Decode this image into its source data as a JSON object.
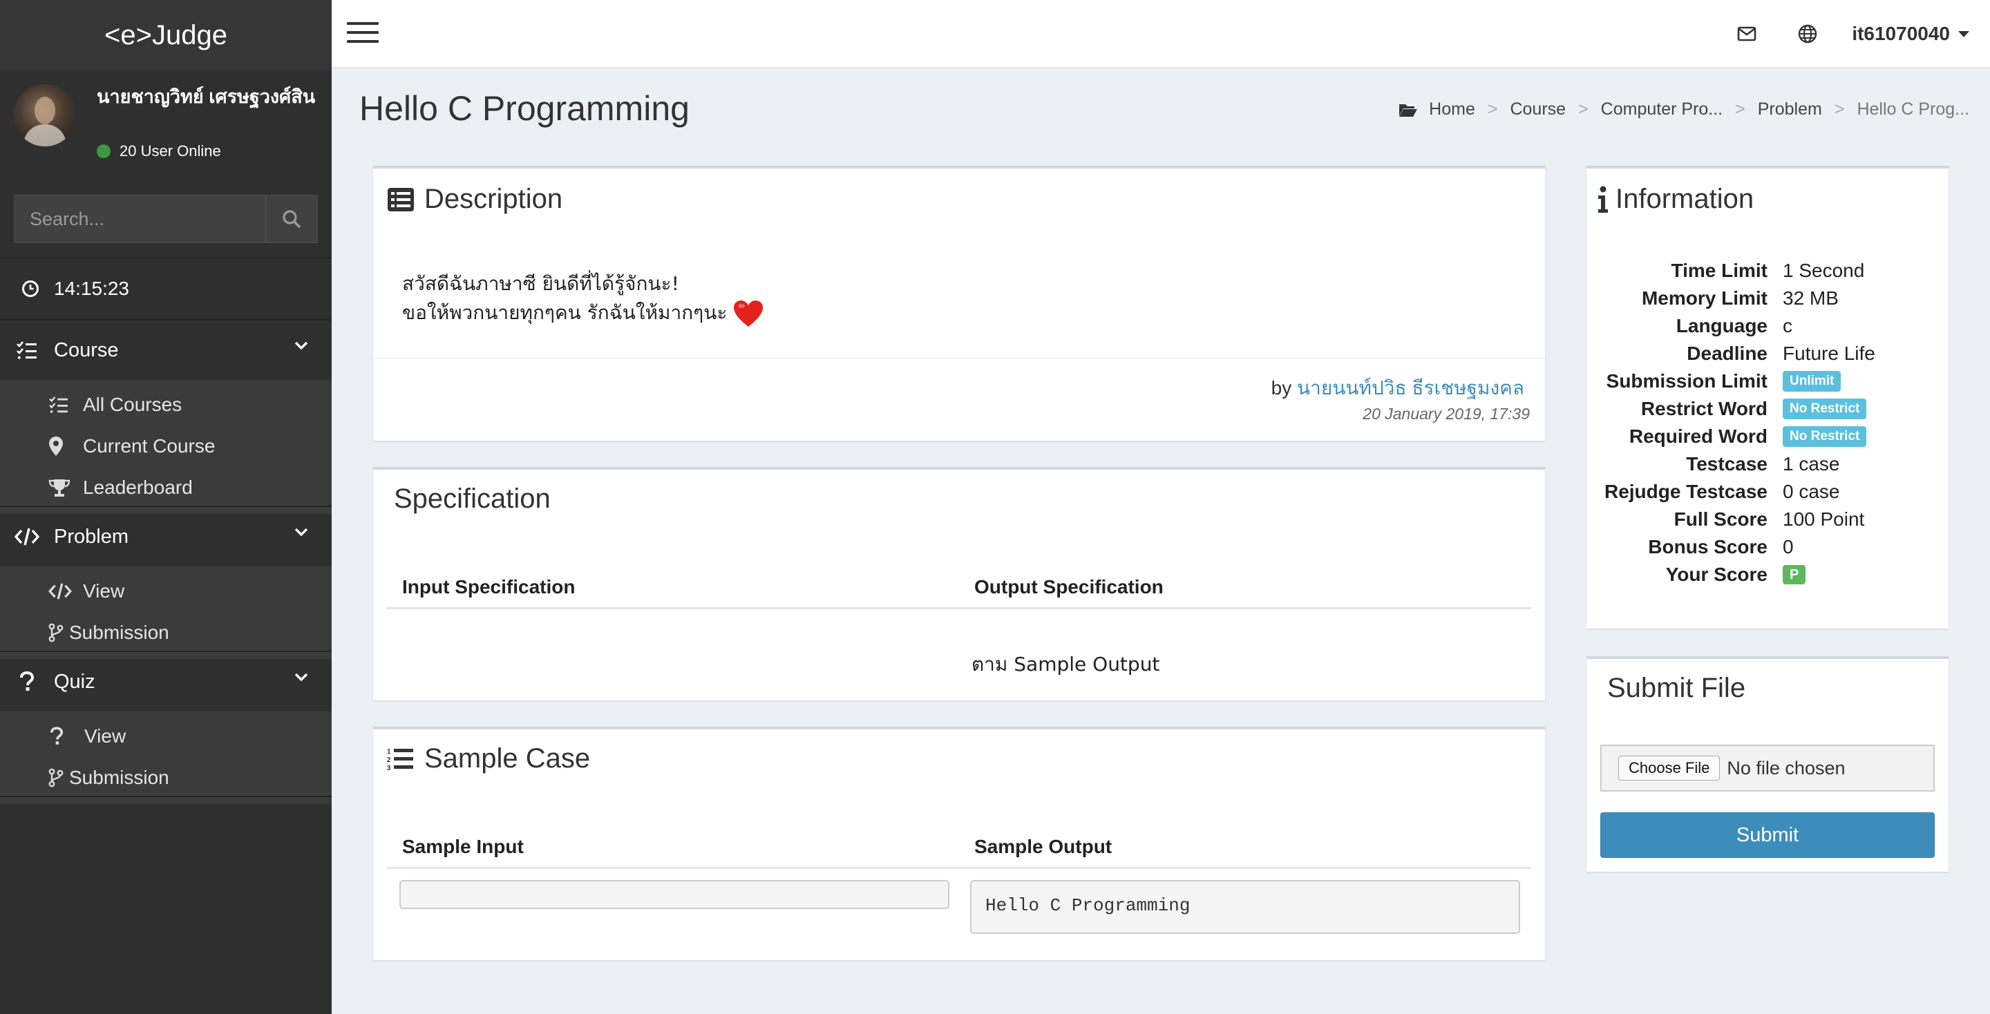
{
  "app": {
    "logo": "<e>Judge"
  },
  "user": {
    "name": "นายชาญวิทย์ เศรษฐวงศ์สิน",
    "online": "20 User Online",
    "username": "it61070040"
  },
  "search": {
    "placeholder": "Search..."
  },
  "clock": "14:15:23",
  "sidebar": {
    "course": {
      "label": "Course",
      "items": [
        "All Courses",
        "Current Course",
        "Leaderboard"
      ]
    },
    "problem": {
      "label": "Problem",
      "items": [
        "View",
        "Submission"
      ]
    },
    "quiz": {
      "label": "Quiz",
      "items": [
        "View",
        "Submission"
      ]
    }
  },
  "page": {
    "title": "Hello C Programming",
    "breadcrumb": [
      "Home",
      "Course",
      "Computer Pro...",
      "Problem",
      "Hello C Prog..."
    ]
  },
  "description": {
    "title": "Description",
    "line1": "สวัสดีฉันภาษาซี ยินดีที่ได้รู้จักนะ!",
    "line2": "ขอให้พวกนายทุกๆคน รักฉันให้มากๆนะ",
    "by": "by",
    "author": "นายนนท์ปวิธ ธีรเชษฐมงคล",
    "date": "20 January 2019, 17:39"
  },
  "specification": {
    "title": "Specification",
    "input_header": "Input Specification",
    "output_header": "Output Specification",
    "input_value": "",
    "output_value": "ตาม Sample Output"
  },
  "sample": {
    "title": "Sample Case",
    "input_header": "Sample Input",
    "output_header": "Sample Output",
    "input_value": "",
    "output_value": "Hello C Programming"
  },
  "information": {
    "title": "Information",
    "rows": [
      {
        "key": "Time Limit",
        "value": "1 Second"
      },
      {
        "key": "Memory Limit",
        "value": "32 MB"
      },
      {
        "key": "Language",
        "value": "c"
      },
      {
        "key": "Deadline",
        "value": "Future Life"
      },
      {
        "key": "Submission Limit",
        "value": "Unlimit"
      },
      {
        "key": "Restrict Word",
        "value": "No Restrict"
      },
      {
        "key": "Required Word",
        "value": "No Restrict"
      },
      {
        "key": "Testcase",
        "value": "1 case"
      },
      {
        "key": "Rejudge Testcase",
        "value": "0 case"
      },
      {
        "key": "Full Score",
        "value": "100 Point"
      },
      {
        "key": "Bonus Score",
        "value": "0"
      },
      {
        "key": "Your Score",
        "value": "P"
      }
    ]
  },
  "submit": {
    "title": "Submit File",
    "choose_label": "Choose File",
    "no_file": "No file chosen",
    "button": "Submit"
  },
  "colors": {
    "sidebar_bg": "#2f2f2f",
    "accent": "#3c8dbc",
    "label_info": "#5bc0de",
    "label_success": "#5cb85c",
    "online_dot": "#3c9a3c"
  },
  "icons": [
    "menu-icon",
    "mail-icon",
    "globe-icon",
    "search-icon",
    "clock-icon",
    "list-check-icon",
    "map-marker-icon",
    "trophy-icon",
    "code-icon",
    "code-branch-icon",
    "question-icon",
    "chevron-down-icon",
    "folder-open-icon",
    "list-alt-icon",
    "info-icon",
    "list-ol-icon",
    "heart-icon"
  ]
}
